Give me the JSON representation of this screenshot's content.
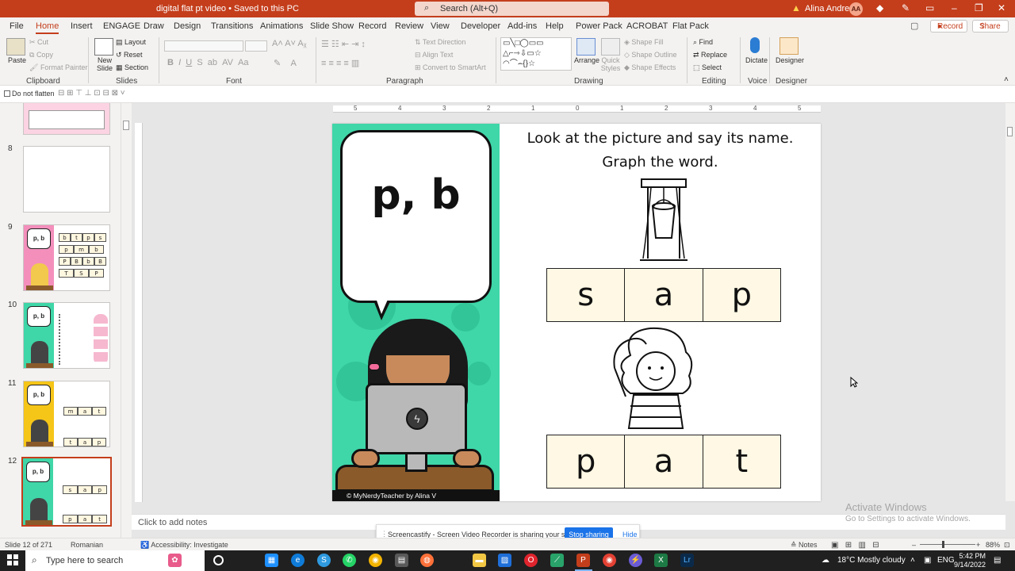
{
  "window": {
    "title": "digital flat pt video • Saved to this PC",
    "search_placeholder": "Search (Alt+Q)",
    "user_name": "Alina Andreea",
    "user_initials": "AA"
  },
  "menu": {
    "tabs": [
      "File",
      "Home",
      "Insert",
      "ENGAGE",
      "Draw",
      "Design",
      "Transitions",
      "Animations",
      "Slide Show",
      "Record",
      "Review",
      "View",
      "Developer",
      "Add-ins",
      "Help",
      "Power Pack",
      "ACROBAT",
      "Flat Pack"
    ],
    "active_tab": "Home",
    "record_label": "Record",
    "share_label": "Share"
  },
  "ribbon": {
    "clipboard": {
      "paste": "Paste",
      "cut": "Cut",
      "copy": "Copy",
      "format_painter": "Format Painter",
      "label": "Clipboard"
    },
    "slides": {
      "new_slide": "New Slide",
      "layout": "Layout",
      "reset": "Reset",
      "section": "Section",
      "label": "Slides"
    },
    "font": {
      "label": "Font"
    },
    "paragraph": {
      "text_direction": "Text Direction",
      "align_text": "Align Text",
      "convert_smartart": "Convert to SmartArt",
      "label": "Paragraph"
    },
    "drawing": {
      "arrange": "Arrange",
      "quick_styles": "Quick Styles",
      "shape_fill": "Shape Fill",
      "shape_outline": "Shape Outline",
      "shape_effects": "Shape Effects",
      "label": "Drawing"
    },
    "editing": {
      "find": "Find",
      "replace": "Replace",
      "select": "Select",
      "label": "Editing"
    },
    "voice": {
      "dictate": "Dictate",
      "label": "Voice"
    },
    "designer": {
      "designer": "Designer",
      "label": "Designer"
    }
  },
  "subbar": {
    "do_not_flatten": "Do not flatten"
  },
  "thumbnails": [
    {
      "num": "8"
    },
    {
      "num": "9",
      "letters": [
        [
          "b",
          "t",
          "p",
          "s"
        ],
        [
          "p",
          "m",
          "b"
        ],
        [
          "P",
          "B",
          "b",
          "B"
        ],
        [
          "T",
          "S",
          "P"
        ]
      ]
    },
    {
      "num": "10"
    },
    {
      "num": "11",
      "letters": [
        [
          "m",
          "a",
          "t"
        ],
        [
          "t",
          "a",
          "p"
        ]
      ]
    },
    {
      "num": "12",
      "letters": [
        [
          "s",
          "a",
          "p"
        ],
        [
          "p",
          "a",
          "t"
        ]
      ]
    }
  ],
  "slide": {
    "bubble_text": "p, b",
    "title_line1": "Look at the picture and say its name.",
    "title_line2": "Graph the word.",
    "word1": [
      "s",
      "a",
      "p"
    ],
    "word2": [
      "p",
      "a",
      "t"
    ],
    "credit": "© MyNerdyTeacher by Alina  V"
  },
  "ruler_top": [
    "5",
    "4",
    "3",
    "2",
    "1",
    "0",
    "1",
    "2",
    "3",
    "4",
    "5"
  ],
  "notes_placeholder": "Click to add notes",
  "activate": {
    "line1": "Activate Windows",
    "line2": "Go to Settings to activate Windows."
  },
  "screencast": {
    "message": "Screencastify - Screen Video Recorder is sharing your screen.",
    "stop": "Stop sharing",
    "hide": "Hide"
  },
  "status": {
    "slide": "Slide 12 of 271",
    "language": "Romanian",
    "accessibility": "Accessibility: Investigate",
    "notes": "Notes",
    "zoom": "88%"
  },
  "taskbar": {
    "search_placeholder": "Type here to search",
    "weather": "18°C  Mostly cloudy",
    "lang": "ENG",
    "time": "5:42 PM",
    "date": "9/14/2022"
  },
  "colors": {
    "accent": "#c43e1c",
    "slide_green": "#3fd6a8",
    "cell_fill": "#fff8e4"
  }
}
